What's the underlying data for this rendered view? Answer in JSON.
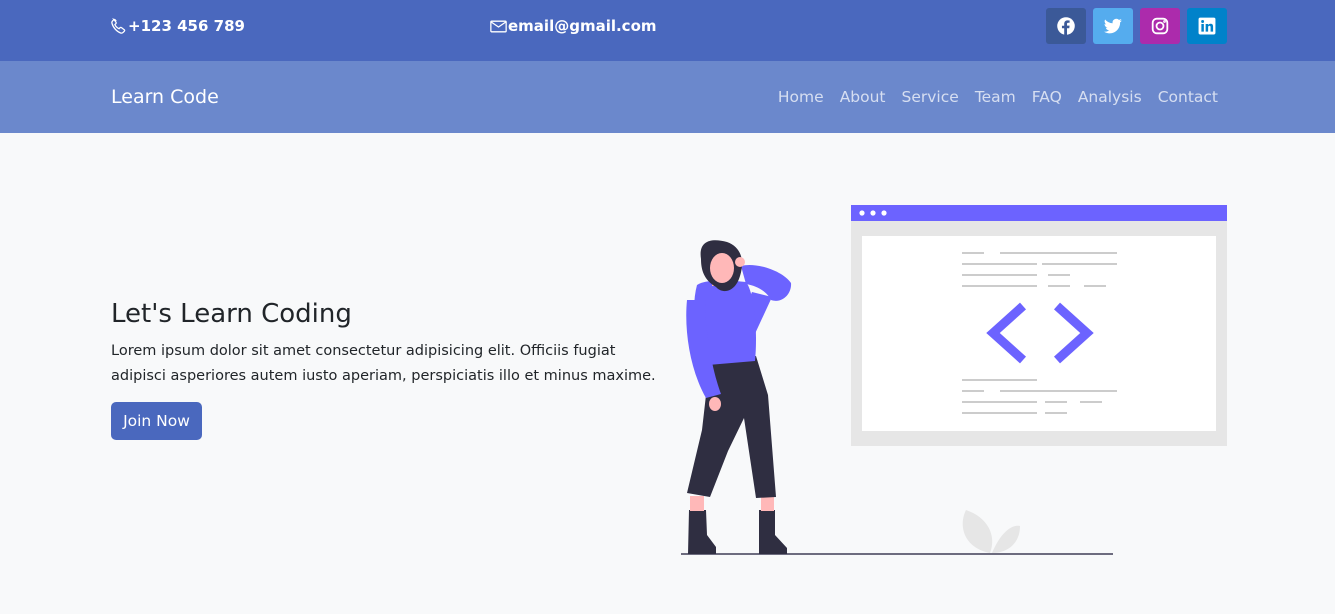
{
  "topbar": {
    "phone_icon": "phone-icon",
    "phone": "+123 456 789",
    "email_icon": "envelope-icon",
    "email": "email@gmail.com",
    "socials": [
      {
        "name": "facebook",
        "icon": "facebook-icon",
        "color": "#3b5998"
      },
      {
        "name": "twitter",
        "icon": "twitter-icon",
        "color": "#55acee"
      },
      {
        "name": "instagram",
        "icon": "instagram-icon",
        "color": "#ac2bac"
      },
      {
        "name": "linkedin",
        "icon": "linkedin-icon",
        "color": "#0082ca"
      }
    ]
  },
  "navbar": {
    "brand": "Learn Code",
    "links": [
      "Home",
      "About",
      "Service",
      "Team",
      "FAQ",
      "Analysis",
      "Contact"
    ]
  },
  "hero": {
    "title": "Let's Learn Coding",
    "text": "Lorem ipsum dolor sit amet consectetur adipisicing elit. Officiis fugiat adipisci asperiores autem iusto aperiam, perspiciatis illo et minus maxime.",
    "button": "Join Now",
    "illustration": "woman-looking-at-code-window"
  },
  "colors": {
    "topbar": "#4a68be",
    "navbar": "#6b88cc",
    "accent": "#6c63ff",
    "background": "#f8f9fa"
  }
}
